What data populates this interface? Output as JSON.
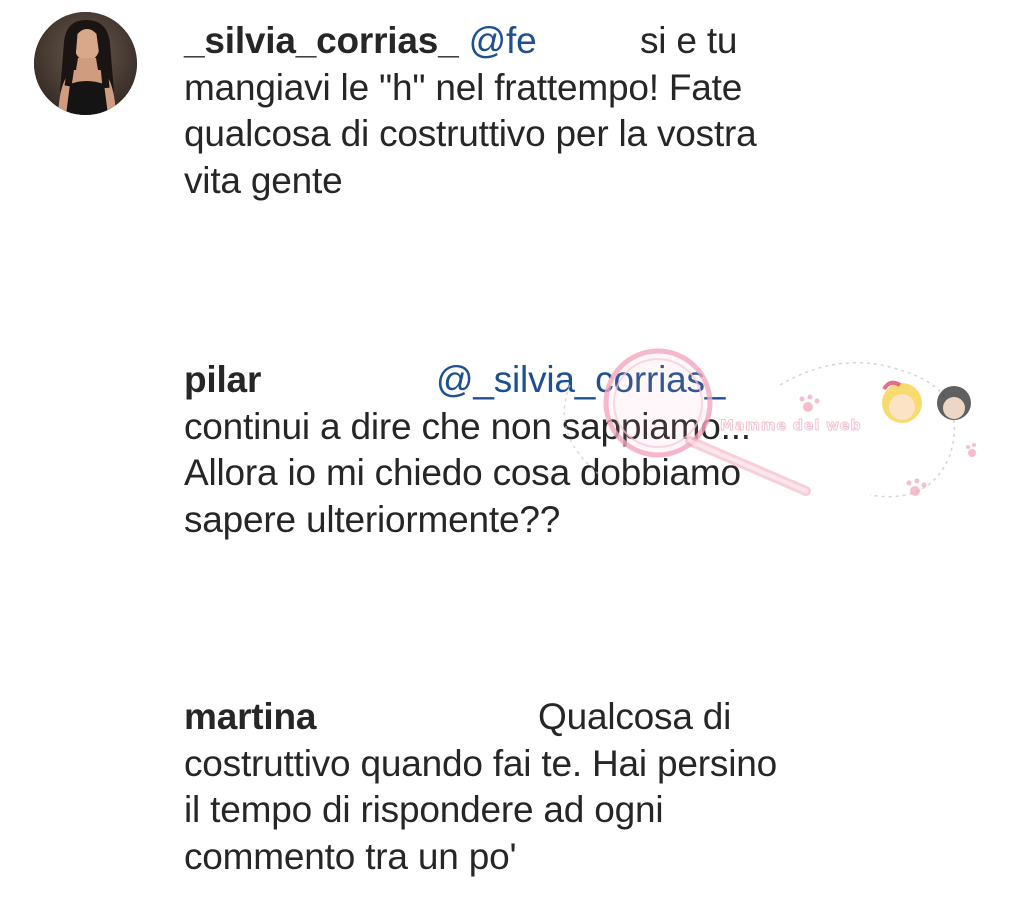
{
  "comments": [
    {
      "username": "_silvia_corrias_",
      "mention": "@fe",
      "lines": {
        "l1_text": "si e tu",
        "l2": "mangiavi le \"h\" nel frattempo! Fate",
        "l3": "qualcosa di costruttivo per la vostra",
        "l4": "vita gente"
      }
    },
    {
      "username": "pilar",
      "mention": "@_silvia_corrias_",
      "lines": {
        "l2": "continui a dire che non sappiamo...",
        "l3": "Allora io mi chiedo cosa dobbiamo",
        "l4": "sapere ulteriormente??"
      }
    },
    {
      "username": "martina",
      "lines": {
        "l1_text": "Qualcosa di",
        "l2": "costruttivo quando fai te. Hai persino",
        "l3": "il tempo di rispondere ad ogni",
        "l4": "commento tra un po'"
      }
    }
  ],
  "watermark": {
    "text": "Mamme del web",
    "colors": {
      "pink": "#f3a7bd",
      "blonde": "#f5d24a",
      "dark_hair": "#2b2b2b"
    }
  },
  "colors": {
    "text": "#262626",
    "mention": "#1d4f91",
    "background": "#ffffff"
  }
}
